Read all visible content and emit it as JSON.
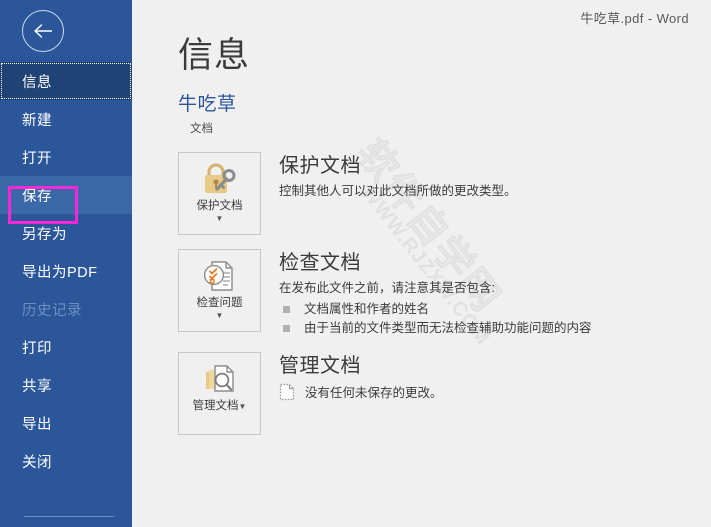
{
  "window": {
    "doc_title": "牛吃草.pdf  -  Word"
  },
  "colors": {
    "sidebar_bg": "#2b579a",
    "sidebar_selected_bg": "#204376",
    "sidebar_hover_bg": "#3a68a8",
    "accent_link": "#2b579a",
    "annotation_box": "#ff26d5",
    "content_bg": "#f0f0f0",
    "bullet": "#b0b0b0"
  },
  "sidebar": {
    "back_icon": "back-arrow-icon",
    "items": [
      {
        "label": "信息",
        "state": "selected"
      },
      {
        "label": "新建",
        "state": "normal"
      },
      {
        "label": "打开",
        "state": "normal"
      },
      {
        "label": "保存",
        "state": "hovered"
      },
      {
        "label": "另存为",
        "state": "normal"
      },
      {
        "label": "导出为PDF",
        "state": "normal"
      },
      {
        "label": "历史记录",
        "state": "disabled"
      },
      {
        "label": "打印",
        "state": "normal"
      },
      {
        "label": "共享",
        "state": "normal"
      },
      {
        "label": "导出",
        "state": "normal"
      },
      {
        "label": "关闭",
        "state": "normal"
      }
    ]
  },
  "watermark": {
    "cn": "软件自学网",
    "en": "WWW.RJZXW.COM"
  },
  "main": {
    "page_title": "信息",
    "doc_name": "牛吃草",
    "doc_sub": "文档",
    "sections": [
      {
        "button_label": "保护文档",
        "button_icon": "lock-key-icon",
        "button_caret": "▼",
        "heading": "保护文档",
        "description": "控制其他人可以对此文档所做的更改类型。",
        "bullets": [],
        "status": null
      },
      {
        "button_label": "检查问题",
        "button_icon": "document-check-icon",
        "button_caret": "▼",
        "heading": "检查文档",
        "description": "在发布此文件之前，请注意其是否包含:",
        "bullets": [
          "文档属性和作者的姓名",
          "由于当前的文件类型而无法检查辅助功能问题的内容"
        ],
        "status": null
      },
      {
        "button_label": "管理文档",
        "button_icon": "document-stack-search-icon",
        "button_caret": "▼",
        "heading": "管理文档",
        "description": "",
        "bullets": [],
        "status": {
          "icon": "dashed-document-icon",
          "text": "没有任何未保存的更改。"
        }
      }
    ]
  }
}
